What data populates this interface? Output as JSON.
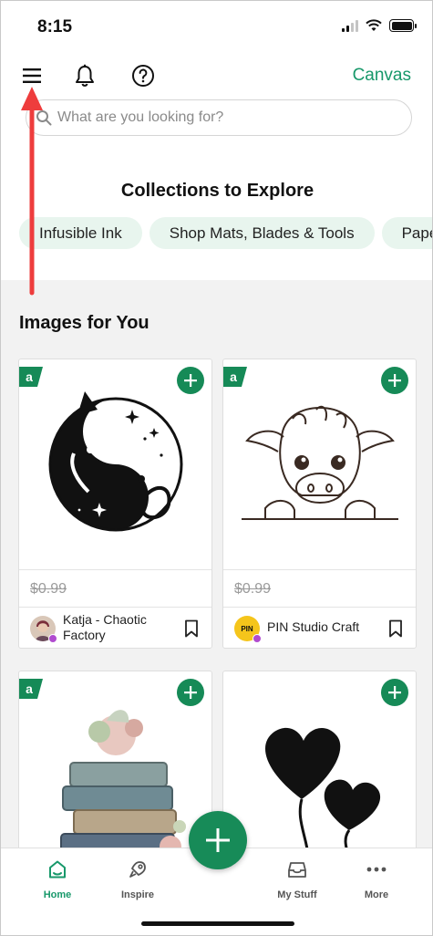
{
  "status_bar": {
    "time": "8:15"
  },
  "top_nav": {
    "canvas_label": "Canvas"
  },
  "search": {
    "placeholder": "What are you looking for?"
  },
  "collections": {
    "title": "Collections to Explore",
    "chips": [
      "Infusible Ink",
      "Shop Mats, Blades & Tools",
      "Pape"
    ]
  },
  "feed": {
    "title": "Images for You",
    "cards": [
      {
        "badge": "a",
        "price": "$0.99",
        "creator": "Katja - Chaotic Factory",
        "image": "yin-yang-cats"
      },
      {
        "badge": "a",
        "price": "$0.99",
        "creator": "PIN Studio Craft",
        "image": "baby-highland-cow",
        "avatar_text": "PIN"
      },
      {
        "badge": "a",
        "image": "book-stack-flowers"
      },
      {
        "image": "heart-balloons"
      }
    ]
  },
  "tabbar": {
    "home": "Home",
    "inspire": "Inspire",
    "my_stuff": "My Stuff",
    "more": "More"
  },
  "colors": {
    "brand_green": "#17986a",
    "chip_bg": "#e8f5ee",
    "feed_bg": "#f2f2f2",
    "annotation_arrow": "#ee3d3d"
  }
}
